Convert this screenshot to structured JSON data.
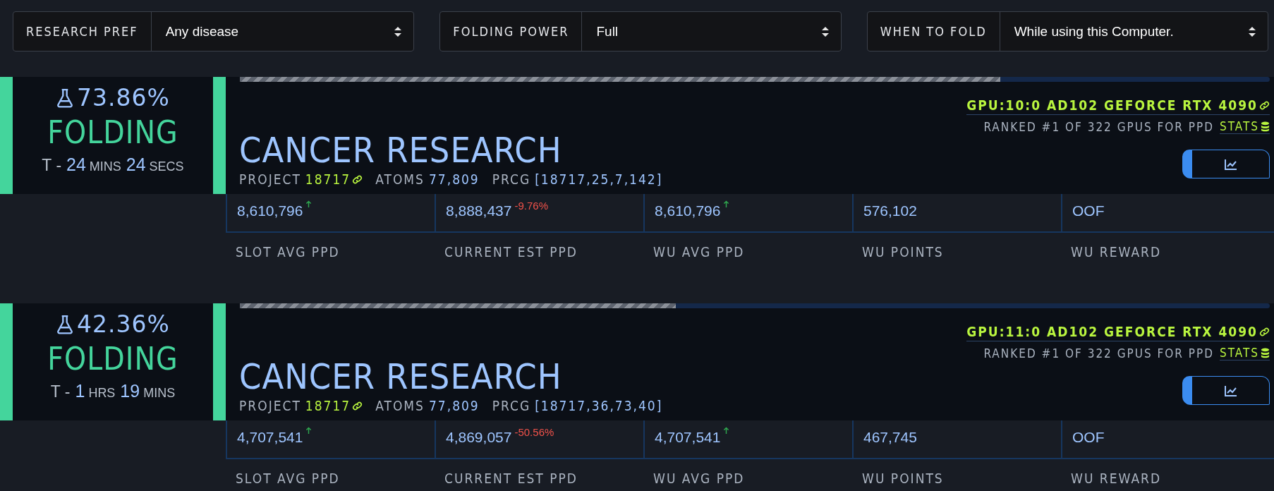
{
  "preferences": [
    {
      "label": "RESEARCH PREF",
      "value": "Any disease"
    },
    {
      "label": "FOLDING POWER",
      "value": "Full"
    },
    {
      "label": "WHEN TO FOLD",
      "value": "While using this Computer."
    }
  ],
  "slots": [
    {
      "progress": "73.86%",
      "level": 0.7386,
      "status": "FOLDING",
      "time": {
        "prefix": "T -",
        "parts": [
          {
            "value": "24",
            "unit": "MINS"
          },
          {
            "value": "24",
            "unit": "SECS"
          }
        ]
      },
      "title": "CANCER RESEARCH",
      "details": [
        {
          "label": "PROJECT",
          "value": "18717",
          "kind": "link"
        },
        {
          "label": "ATOMS",
          "value": "77,809",
          "kind": "plain"
        },
        {
          "label": "PRCG",
          "value": "[18717,25,7,142]",
          "kind": "plain"
        }
      ],
      "gpu": "GPU:10:0 AD102 GEFORCE RTX 4090",
      "ranking": "RANKED #1 OF 322 GPUS FOR PPD",
      "stats_link": "STATS",
      "metrics": [
        {
          "value": "8,610,796",
          "kind": "rising",
          "label": "SLOT AVG PPD"
        },
        {
          "value": "8,888,437",
          "kind": "change",
          "delta": "-9.76%",
          "label": "CURRENT EST PPD"
        },
        {
          "value": "8,610,796",
          "kind": "rising",
          "label": "WU AVG PPD"
        },
        {
          "value": "576,102",
          "kind": "plain",
          "label": "WU POINTS"
        },
        {
          "value": "OOF",
          "kind": "plain",
          "label": "WU REWARD"
        }
      ]
    },
    {
      "progress": "42.36%",
      "level": 0.4236,
      "status": "FOLDING",
      "time": {
        "prefix": "T -",
        "parts": [
          {
            "value": "1",
            "unit": "HRS"
          },
          {
            "value": "19",
            "unit": "MINS"
          }
        ]
      },
      "title": "CANCER RESEARCH",
      "details": [
        {
          "label": "PROJECT",
          "value": "18717",
          "kind": "link"
        },
        {
          "label": "ATOMS",
          "value": "77,809",
          "kind": "plain"
        },
        {
          "label": "PRCG",
          "value": "[18717,36,73,40]",
          "kind": "plain"
        }
      ],
      "gpu": "GPU:11:0 AD102 GEFORCE RTX 4090",
      "ranking": "RANKED #1 OF 322 GPUS FOR PPD",
      "stats_link": "STATS",
      "metrics": [
        {
          "value": "4,707,541",
          "kind": "rising",
          "label": "SLOT AVG PPD"
        },
        {
          "value": "4,869,057",
          "kind": "change",
          "delta": "-50.56%",
          "label": "CURRENT EST PPD"
        },
        {
          "value": "4,707,541",
          "kind": "rising",
          "label": "WU AVG PPD"
        },
        {
          "value": "467,745",
          "kind": "plain",
          "label": "WU POINTS"
        },
        {
          "value": "OOF",
          "kind": "plain",
          "label": "WU REWARD"
        }
      ]
    }
  ]
}
